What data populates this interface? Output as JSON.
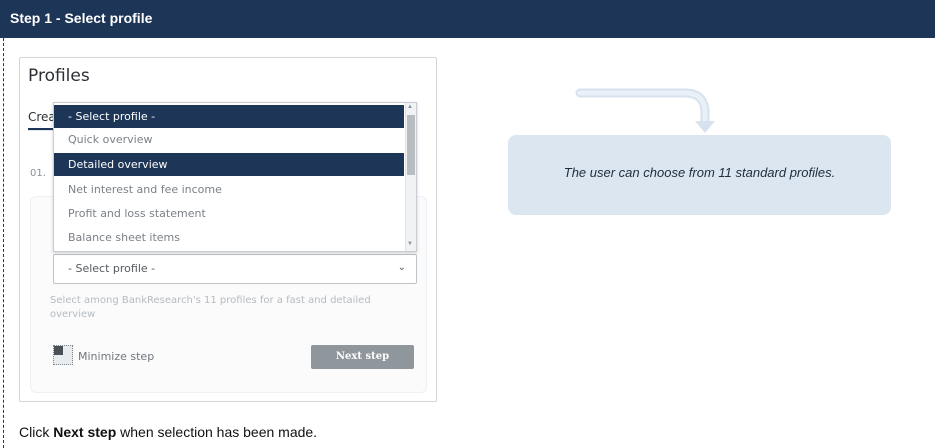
{
  "header": {
    "title": "Step 1 - Select profile"
  },
  "screenshot": {
    "title": "Profiles",
    "tab_label": "Crea",
    "step_label": "01.",
    "dropdown": {
      "items": [
        {
          "label": "- Select profile -",
          "state": "header"
        },
        {
          "label": "Quick overview",
          "state": "normal"
        },
        {
          "label": "Detailed overview",
          "state": "selected"
        },
        {
          "label": "Net interest and fee income",
          "state": "normal"
        },
        {
          "label": "Profit and loss statement",
          "state": "normal"
        },
        {
          "label": "Balance sheet items",
          "state": "normal"
        }
      ]
    },
    "select": {
      "value": "- Select profile -"
    },
    "helper_text": "Select among BankResearch's 11 profiles for a fast and detailed overview",
    "minimize_label": "Minimize step",
    "next_button_label": "Next step"
  },
  "callout": {
    "text": "The user can choose from 11 standard profiles."
  },
  "footer": {
    "prefix": "Click ",
    "bold": "Next step",
    "suffix": " when selection has been made."
  },
  "colors": {
    "header_bg": "#1d3557",
    "callout_bg": "#dbe6f1",
    "button_bg": "#8f969c"
  },
  "icons": [
    "minimize-icon",
    "chevron-down-icon",
    "curved-arrow-icon"
  ]
}
